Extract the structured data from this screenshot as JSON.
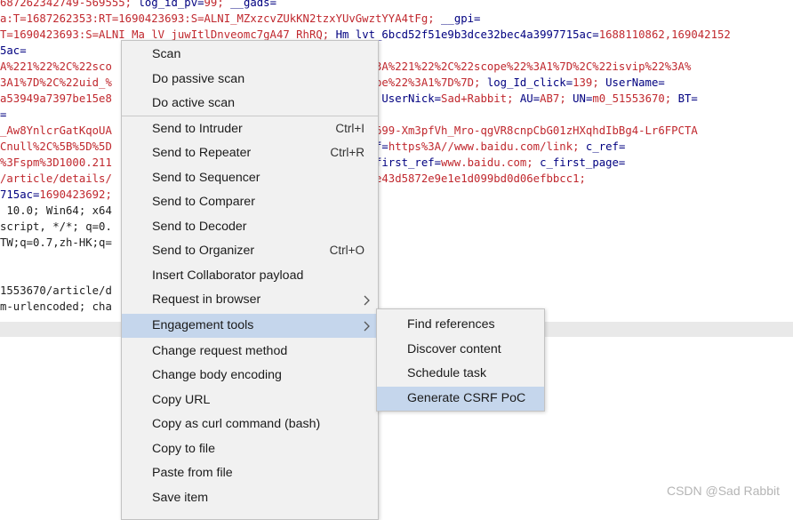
{
  "editor_lines": [
    [
      {
        "t": "687262342749-569555; ",
        "c": "r"
      },
      {
        "t": "log_id_pv=",
        "c": "k"
      },
      {
        "t": "99; ",
        "c": "r"
      },
      {
        "t": "__gads=",
        "c": "k"
      }
    ],
    [
      {
        "t": "a:T=1687262353:RT=1690423693:S=ALNI_MZxzcvZUkKN2tzxYUvGwztYYA4tFg; ",
        "c": "r"
      },
      {
        "t": "__gpi=",
        "c": "k"
      }
    ],
    [
      {
        "t": "T=1690423693:S=ALNI_Ma_lV_juwItlDnveomc7gA47_RhRQ; ",
        "c": "r"
      },
      {
        "t": "Hm_lvt_6bcd52f51e9b3dce32bec4a3997715ac=",
        "c": "k"
      },
      {
        "t": "1688110862,169042152",
        "c": "r"
      }
    ],
    [
      {
        "t": "5ac=",
        "c": "k"
      }
    ],
    [
      {
        "t": "A%221%22%2C%22sco                              2value%22%3A%221%22%2C%22scope%22%3A1%7D%2C%22isvip%22%3A%",
        "c": "r"
      }
    ],
    [
      {
        "t": "3A1%7D%2C%22uid_%                              2%2C%22scope%22%3A1%7D%7D; ",
        "c": "r"
      },
      {
        "t": "log_Id_click=",
        "c": "k"
      },
      {
        "t": "139; ",
        "c": "r"
      },
      {
        "t": "UserName=",
        "c": "k"
      }
    ],
    [
      {
        "t": "a53949a7397be15e8                              7be15e889; ",
        "c": "r"
      },
      {
        "t": "UserNick=",
        "c": "k"
      },
      {
        "t": "Sad+Rabbit; ",
        "c": "r"
      },
      {
        "t": "AU=",
        "c": "k"
      },
      {
        "t": "AB7; ",
        "c": "r"
      },
      {
        "t": "UN=",
        "c": "k"
      },
      {
        "t": "m0_51553670; ",
        "c": "r"
      },
      {
        "t": "BT=",
        "c": "k"
      }
    ],
    [
      {
        "t": "=",
        "c": "k"
      }
    ],
    [
      {
        "t": "_Aw8YnlcrGatKqoUA                              gcohd-gTQA699-Xm3pfVh_Mro-qgVR8cnpCbG01zHXqhdIbBg4-Lr6FPCTA",
        "c": "r"
      }
    ],
    [
      {
        "t": "Cnull%2C%5B%5D%5D                              022; ",
        "c": "r"
      },
      {
        "t": "c_pref=",
        "c": "k"
      },
      {
        "t": "https%3A//www.baidu.com/link; ",
        "c": "r"
      },
      {
        "t": "c_ref=",
        "c": "k"
      }
    ],
    [
      {
        "t": "%3Fspm%3D1000.211                              551581; ",
        "c": "r"
      },
      {
        "t": "c_first_ref=",
        "c": "k"
      },
      {
        "t": "www.baidu.com; ",
        "c": "r"
      },
      {
        "t": "c_first_page=",
        "c": "k"
      }
    ],
    [
      {
        "t": "/article/details/                              ; ",
        "c": "r"
      },
      {
        "t": "dc_sid=",
        "c": "k"
      },
      {
        "t": "ee43d5872e9e1e1d099bd0d06efbbcc1;",
        "c": "r"
      }
    ],
    [
      {
        "t": "715ac=",
        "c": "k"
      },
      {
        "t": "1690423692;",
        "c": "r"
      }
    ],
    [
      {
        "t": " 10.0; Win64; x64                              5.0",
        "c": "d"
      }
    ],
    [
      {
        "t": "script, */*; q=0.",
        "c": "d"
      }
    ],
    [
      {
        "t": "TW;q=0.7,zh-HK;q=",
        "c": "d"
      }
    ],
    [
      {
        "t": "",
        "c": "d"
      }
    ],
    [
      {
        "t": "1553670/article/d                              6501",
        "c": "d"
      }
    ],
    [
      {
        "t": "m-urlencoded; cha",
        "c": "d"
      }
    ]
  ],
  "context_menu": {
    "items": [
      {
        "label": "Scan",
        "shortcut": "",
        "submenu": false,
        "highlighted": false,
        "sep_after": false
      },
      {
        "label": "Do passive scan",
        "shortcut": "",
        "submenu": false,
        "highlighted": false,
        "sep_after": false
      },
      {
        "label": "Do active scan",
        "shortcut": "",
        "submenu": false,
        "highlighted": false,
        "sep_after": true
      },
      {
        "label": "Send to Intruder",
        "shortcut": "Ctrl+I",
        "submenu": false,
        "highlighted": false,
        "sep_after": false
      },
      {
        "label": "Send to Repeater",
        "shortcut": "Ctrl+R",
        "submenu": false,
        "highlighted": false,
        "sep_after": false
      },
      {
        "label": "Send to Sequencer",
        "shortcut": "",
        "submenu": false,
        "highlighted": false,
        "sep_after": false
      },
      {
        "label": "Send to Comparer",
        "shortcut": "",
        "submenu": false,
        "highlighted": false,
        "sep_after": false
      },
      {
        "label": "Send to Decoder",
        "shortcut": "",
        "submenu": false,
        "highlighted": false,
        "sep_after": false
      },
      {
        "label": "Send to Organizer",
        "shortcut": "Ctrl+O",
        "submenu": false,
        "highlighted": false,
        "sep_after": false
      },
      {
        "label": "Insert Collaborator payload",
        "shortcut": "",
        "submenu": false,
        "highlighted": false,
        "sep_after": false
      },
      {
        "label": "Request in browser",
        "shortcut": "",
        "submenu": true,
        "highlighted": false,
        "sep_after": false
      },
      {
        "label": "Engagement tools",
        "shortcut": "",
        "submenu": true,
        "highlighted": true,
        "sep_after": false
      },
      {
        "label": "Change request method",
        "shortcut": "",
        "submenu": false,
        "highlighted": false,
        "sep_after": false
      },
      {
        "label": "Change body encoding",
        "shortcut": "",
        "submenu": false,
        "highlighted": false,
        "sep_after": false
      },
      {
        "label": "Copy URL",
        "shortcut": "",
        "submenu": false,
        "highlighted": false,
        "sep_after": false
      },
      {
        "label": "Copy as curl command (bash)",
        "shortcut": "",
        "submenu": false,
        "highlighted": false,
        "sep_after": false
      },
      {
        "label": "Copy to file",
        "shortcut": "",
        "submenu": false,
        "highlighted": false,
        "sep_after": false
      },
      {
        "label": "Paste from file",
        "shortcut": "",
        "submenu": false,
        "highlighted": false,
        "sep_after": false
      },
      {
        "label": "Save item",
        "shortcut": "",
        "submenu": false,
        "highlighted": false,
        "sep_after": false
      }
    ]
  },
  "engagement_submenu": {
    "items": [
      {
        "label": "Find references",
        "highlighted": false
      },
      {
        "label": "Discover content",
        "highlighted": false
      },
      {
        "label": "Schedule task",
        "highlighted": false
      },
      {
        "label": "Generate CSRF PoC",
        "highlighted": true
      }
    ]
  },
  "watermark": "CSDN @Sad Rabbit",
  "colors": {
    "menu_bg": "#f1f1f1",
    "highlight": "#c5d6ec",
    "param_name": "#000080",
    "param_value": "#c0282e"
  }
}
